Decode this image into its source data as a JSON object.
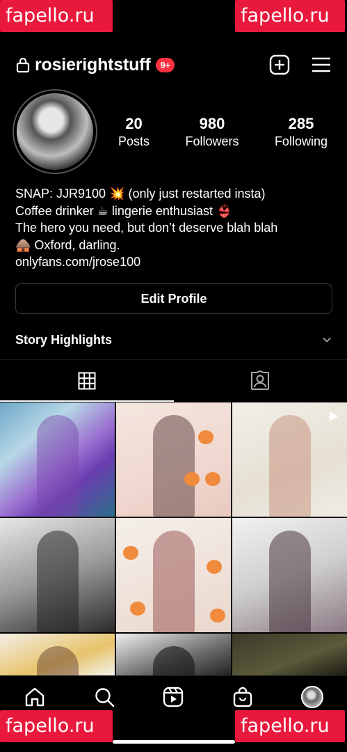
{
  "watermark": {
    "text": "fapello.ru"
  },
  "header": {
    "username": "rosierightstuff",
    "badge": "9+",
    "icons": [
      "lock-icon",
      "new-post-icon",
      "menu-icon"
    ]
  },
  "profile": {
    "stats": [
      {
        "value": "20",
        "label": "Posts"
      },
      {
        "value": "980",
        "label": "Followers"
      },
      {
        "value": "285",
        "label": "Following"
      }
    ],
    "bio": [
      "SNAP: JJR9100 💥  (only just restarted insta)",
      "Coffee drinker ☕ lingerie enthusiast 👙",
      "The hero you need, but don’t deserve blah blah",
      "🛖 Oxford, darling.",
      "onlyfans.com/jrose100"
    ]
  },
  "actions": {
    "edit_profile": "Edit Profile"
  },
  "highlights": {
    "label": "Story Highlights"
  },
  "tabs": [
    {
      "icon": "grid-icon",
      "active": true
    },
    {
      "icon": "tagged-icon",
      "active": false
    }
  ],
  "bottom_nav": [
    "home-icon",
    "search-icon",
    "reels-icon",
    "shop-icon",
    "profile-avatar"
  ],
  "colors": {
    "background": "#000000",
    "badge": "#ff3040",
    "watermark": "#e8193c"
  }
}
